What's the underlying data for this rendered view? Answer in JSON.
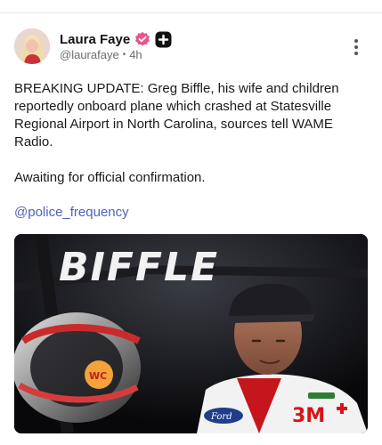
{
  "post": {
    "author_name": "Laura Faye",
    "handle": "@laurafaye",
    "separator": "•",
    "time": "4h",
    "icons": {
      "verified": "verified-badge-icon",
      "plus": "plus-badge-icon",
      "more": "more-vertical-icon"
    },
    "text_para1": "BREAKING UPDATE: Greg Biffle, his wife and children reportedly onboard plane which crashed at Statesville Regional Airport in North Carolina, sources tell WAME Radio.",
    "text_para2": "Awaiting for official confirmation.",
    "mention": "@police_frequency"
  },
  "media": {
    "banner_text": "BIFFLE",
    "sponsor_3m": "3M",
    "sponsor_ford": "Ford",
    "helmet_logo": "WC"
  },
  "colors": {
    "mention": "#4f5fbd",
    "verified": "#e8548b",
    "meta_text": "#6d6d73"
  }
}
